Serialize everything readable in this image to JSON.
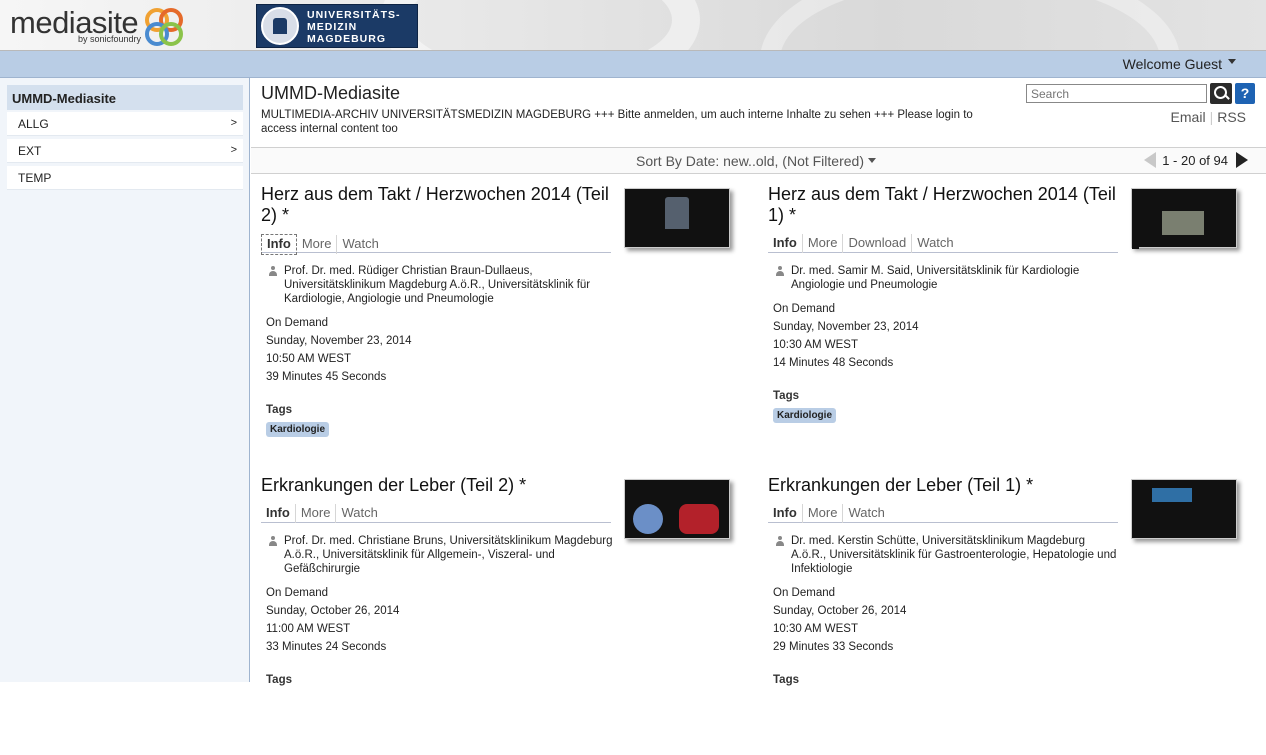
{
  "header": {
    "brand_word": "mediasite",
    "brand_by": "by sonicfoundry",
    "uni_logo_lines": [
      "UNIVERSITÄTS-",
      "MEDIZIN",
      "MAGDEBURG"
    ],
    "welcome_label": "Welcome Guest"
  },
  "sidebar": {
    "title": "UMMD-Mediasite",
    "items": [
      {
        "label": "ALLG",
        "arrow": ">"
      },
      {
        "label": "EXT",
        "arrow": ">"
      },
      {
        "label": "TEMP",
        "arrow": ""
      }
    ]
  },
  "main": {
    "title": "UMMD-Mediasite",
    "description": "MULTIMEDIA-ARCHIV UNIVERSITÄTSMEDIZIN MAGDEBURG +++ Bitte anmelden, um auch interne Inhalte zu sehen +++ Please login to access internal content too",
    "search_placeholder": "Search",
    "help_label": "?",
    "feeds": [
      "Email",
      "RSS"
    ],
    "sort_label": "Sort By Date: new..old, (Not Filtered)",
    "pager_label": "1 - 20 of 94"
  },
  "cards": [
    {
      "title": "Herz aus dem Takt / Herzwochen 2014 (Teil 2) *",
      "tabs": [
        "Info",
        "More",
        "Watch"
      ],
      "presenter": "Prof. Dr. med. Rüdiger Christian Braun-Dullaeus, Universitätsklinikum Magdeburg A.ö.R., Universitätsklinik für Kardiologie, Angiologie und Pneumologie",
      "type": "On Demand",
      "date": "Sunday, November 23, 2014",
      "time": "10:50 AM WEST",
      "duration": "39 Minutes 45 Seconds",
      "tags_label": "Tags",
      "tag": "Kardiologie"
    },
    {
      "title": "Herz aus dem Takt / Herzwochen 2014 (Teil 1) *",
      "tabs": [
        "Info",
        "More",
        "Download",
        "Watch"
      ],
      "presenter": "Dr. med. Samir M. Said, Universitätsklinik für Kardiologie Angiologie und Pneumologie",
      "type": "On Demand",
      "date": "Sunday, November 23, 2014",
      "time": "10:30 AM WEST",
      "duration": "14 Minutes 48 Seconds",
      "tags_label": "Tags",
      "tag": "Kardiologie"
    },
    {
      "title": "Erkrankungen der Leber (Teil 2) *",
      "tabs": [
        "Info",
        "More",
        "Watch"
      ],
      "presenter": "Prof. Dr. med. Christiane Bruns, Universitätsklinikum Magdeburg A.ö.R., Universitätsklinik für Allgemein-, Viszeral- und Gefäßchirurgie",
      "type": "On Demand",
      "date": "Sunday, October 26, 2014",
      "time": "11:00 AM WEST",
      "duration": "33 Minutes 24 Seconds",
      "tags_label": "Tags"
    },
    {
      "title": "Erkrankungen der Leber (Teil 1) *",
      "tabs": [
        "Info",
        "More",
        "Watch"
      ],
      "presenter": "Dr. med. Kerstin Schütte, Universitätsklinikum Magdeburg A.ö.R., Universitätsklinik für Gastroenterologie, Hepatologie und Infektiologie",
      "type": "On Demand",
      "date": "Sunday, October 26, 2014",
      "time": "10:30 AM WEST",
      "duration": "29 Minutes 33 Seconds",
      "tags_label": "Tags"
    }
  ]
}
